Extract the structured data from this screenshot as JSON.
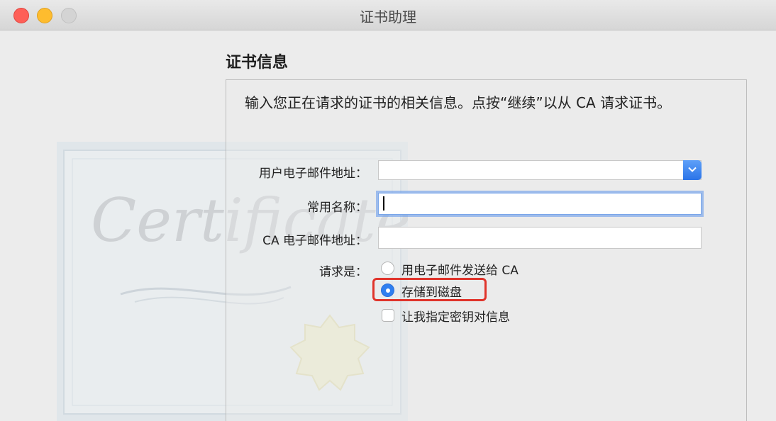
{
  "window": {
    "title": "证书助理"
  },
  "watermark": {
    "text": "Certificate"
  },
  "page": {
    "heading": "证书信息",
    "description": "输入您正在请求的证书的相关信息。点按“继续”以从 CA 请求证书。"
  },
  "form": {
    "email_label": "用户电子邮件地址：",
    "email_value": "",
    "common_name_label": "常用名称：",
    "common_name_value": "",
    "ca_email_label": "CA 电子邮件地址：",
    "ca_email_value": "",
    "request_label": "请求是：",
    "options": [
      {
        "label": "用电子邮件发送给 CA",
        "selected": false
      },
      {
        "label": "存储到磁盘",
        "selected": true
      }
    ],
    "checkbox": {
      "label": "让我指定密钥对信息",
      "checked": false
    }
  },
  "colors": {
    "accent": "#2f7ff0",
    "highlight": "#e0342b"
  },
  "icons": [
    "chevron-down-icon",
    "close-button-icon",
    "minimize-button-icon",
    "zoom-button-icon"
  ]
}
